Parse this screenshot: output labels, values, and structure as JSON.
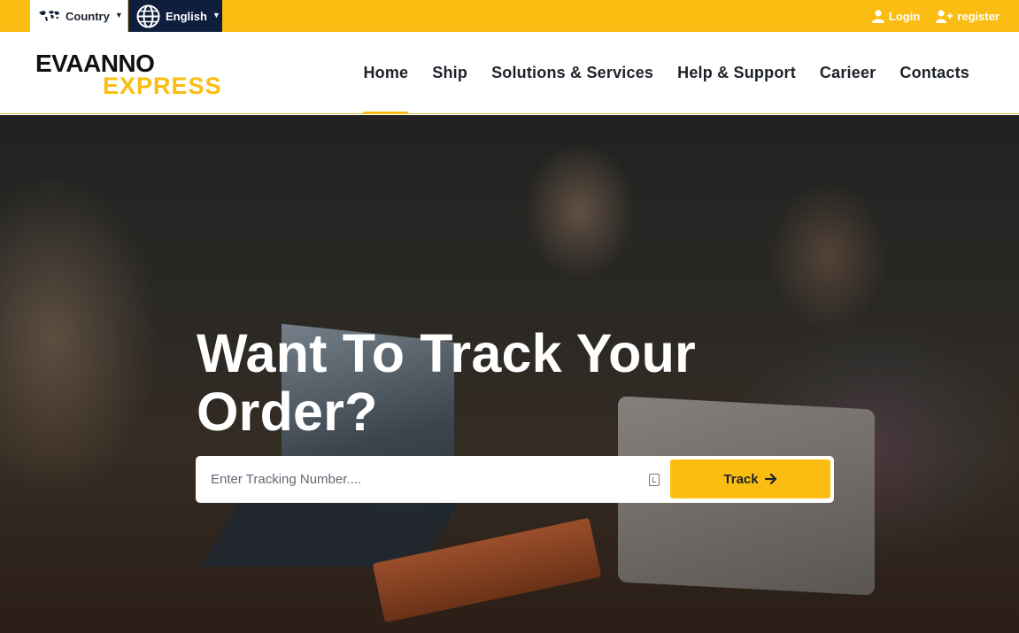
{
  "topbar": {
    "country_label": "Country",
    "language_label": "English",
    "login_label": "Login",
    "register_label": "register"
  },
  "header": {
    "logo_line1": "EVAANNO",
    "logo_line2": "EXPRESS",
    "nav": [
      {
        "label": "Home",
        "active": true
      },
      {
        "label": "Ship"
      },
      {
        "label": "Solutions & Services"
      },
      {
        "label": "Help & Support"
      },
      {
        "label": "Carieer"
      },
      {
        "label": "Contacts"
      }
    ]
  },
  "hero": {
    "title": "Want To Track Your Order?",
    "tracking_placeholder": "Enter Tracking Number....",
    "track_button": "Track"
  },
  "colors": {
    "accent": "#fbbd12",
    "navy": "#0f1e3c"
  }
}
